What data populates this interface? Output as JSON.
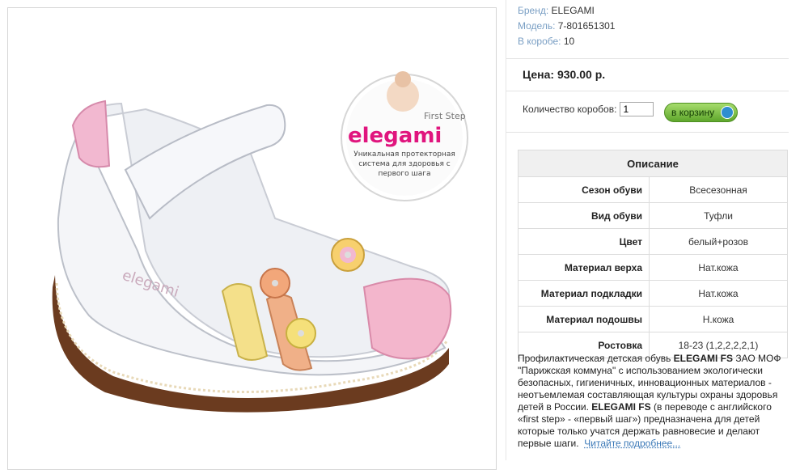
{
  "product": {
    "brand_label": "Бренд:",
    "brand_value": "ELEGAMI",
    "model_label": "Модель:",
    "model_value": "7-801651301",
    "box_label": "В коробе:",
    "box_value": "10",
    "price_text": "Цена: 930.00 р.",
    "qty_label": "Количество коробов:",
    "qty_value": "1",
    "cart_button_label": "в корзину"
  },
  "logo": {
    "brand_text": "elegami",
    "sub_text": "First Step",
    "tagline_1": "Уникальная протекторная",
    "tagline_2": "система для здоровья с",
    "tagline_3": "первого шага",
    "insole_text": "elegami"
  },
  "description": {
    "title": "Описание",
    "rows": [
      {
        "key": "Сезон обуви",
        "value": "Всесезонная"
      },
      {
        "key": "Вид обуви",
        "value": "Туфли"
      },
      {
        "key": "Цвет",
        "value": "белый+розов"
      },
      {
        "key": "Материал верха",
        "value": "Нат.кожа"
      },
      {
        "key": "Материал подкладки",
        "value": "Нат.кожа"
      },
      {
        "key": "Материал подошвы",
        "value": "Н.кожа"
      },
      {
        "key": "Ростовка",
        "value": "18-23 (1,2,2,2,2,1)"
      }
    ],
    "para_1": "Профилактическая детская обувь ",
    "brand_bold_1": "ELEGAMI FS",
    "para_2": " ЗАО МОФ \"Парижская коммуна\" с использованием экологически безопасных, гигиеничных, инновационных материалов - неотъемлемая составляющая культуры охраны здоровья детей в России. ",
    "brand_bold_2": "ELEGAMI FS",
    "para_3": " (в переводе с английского «first step» - «первый шаг») предназначена для детей которые только учатся держать равновесие и делают первые шаги.",
    "read_more": "Читайте подробнее..."
  },
  "colors": {
    "label_blue": "#7a9fc4",
    "cart_green": "#6cb33a",
    "link_blue": "#3a78b7",
    "logo_pink": "#e0157e"
  }
}
